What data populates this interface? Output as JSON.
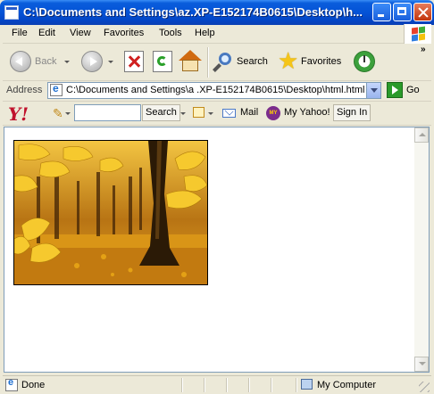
{
  "window": {
    "title": "C:\\Documents and Settings\\az.XP-E152174B0615\\Desktop\\h..."
  },
  "menu": {
    "items": [
      "File",
      "Edit",
      "View",
      "Favorites",
      "Tools",
      "Help"
    ]
  },
  "toolbar": {
    "back_label": "Back",
    "search_label": "Search",
    "favorites_label": "Favorites",
    "overflow": "»"
  },
  "address": {
    "label": "Address",
    "value": "C:\\Documents and Settings\\a  .XP-E152174B0615\\Desktop\\html.html",
    "go_label": "Go"
  },
  "yahoo_toolbar": {
    "logo": "Y!",
    "search_value": "",
    "search_label": "Search",
    "mail_label": "Mail",
    "my_yahoo_label": "My Yahoo!",
    "my_yahoo_icon": "MY",
    "signin_label": "Sign In"
  },
  "content": {
    "image_alt": "Autumn forest with yellow leaves"
  },
  "status": {
    "text": "Done",
    "zone": "My Computer"
  },
  "colors": {
    "titlebar": "#0453d6",
    "chrome": "#ece9d8",
    "yahoo_red": "#c0122d"
  }
}
